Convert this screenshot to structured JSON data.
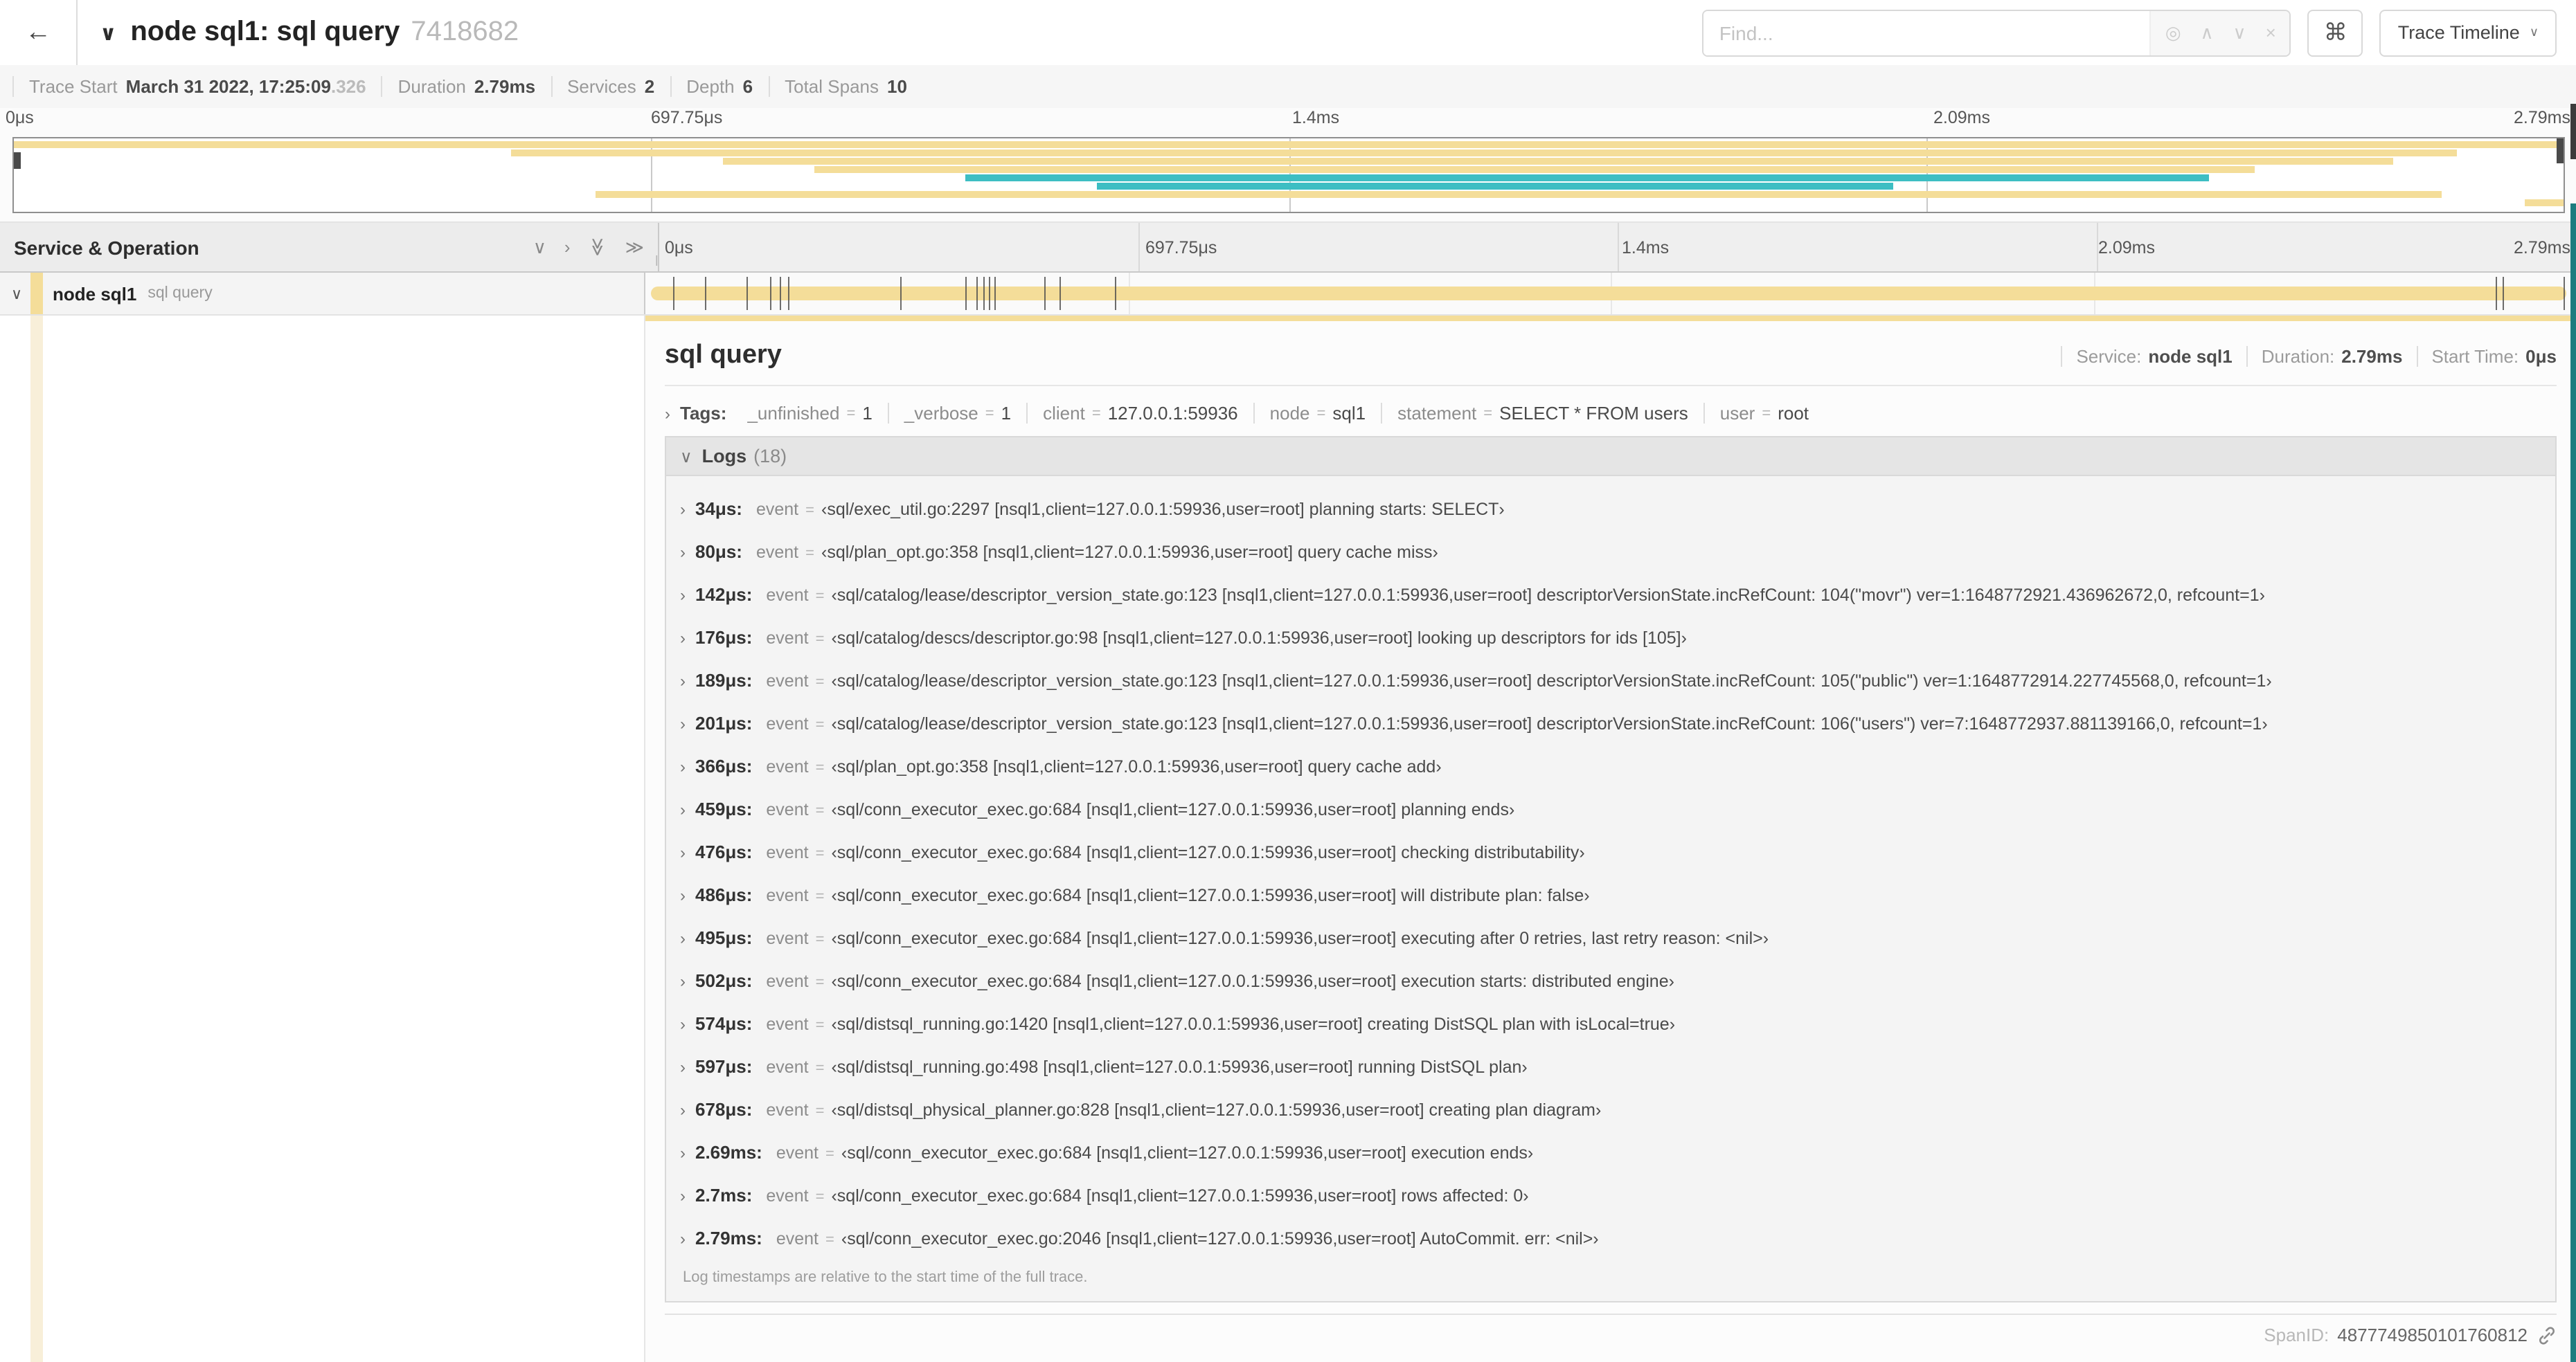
{
  "icons": {
    "back": "←",
    "chevron_down": "∨",
    "chevron_up": "∧",
    "chevron_right": "›",
    "double_chevron": "≫",
    "locate": "◎",
    "clear": "×",
    "command": "⌘",
    "grip": "‖"
  },
  "colors": {
    "span_tan": "#F4DD99",
    "span_teal": "#3DBEC3",
    "faded_tan": "#F8EFD9"
  },
  "header": {
    "title": "node sql1: sql query",
    "trace_id": "7418682",
    "find_placeholder": "Find...",
    "view_dropdown": "Trace Timeline"
  },
  "summary": {
    "items": [
      {
        "label": "Trace Start",
        "value": "March 31 2022, 17:25:09",
        "suffix": ".326"
      },
      {
        "label": "Duration",
        "value": "2.79ms"
      },
      {
        "label": "Services",
        "value": "2"
      },
      {
        "label": "Depth",
        "value": "6"
      },
      {
        "label": "Total Spans",
        "value": "10"
      }
    ]
  },
  "timeline": {
    "ticks": [
      "0μs",
      "697.75μs",
      "1.4ms",
      "2.09ms",
      "2.79ms"
    ],
    "duration_us": 2790,
    "log_marker_times_us": [
      34,
      80,
      142,
      176,
      189,
      201,
      366,
      459,
      476,
      486,
      495,
      502,
      574,
      597,
      678,
      2690,
      2700,
      2790
    ],
    "minimap_rows": [
      {
        "color": "tan",
        "start": 0,
        "end": 1
      },
      {
        "color": "tan",
        "start": 0.195,
        "end": 0.958
      },
      {
        "color": "tan",
        "start": 0.278,
        "end": 0.933
      },
      {
        "color": "tan",
        "start": 0.314,
        "end": 0.879
      },
      {
        "color": "teal",
        "start": 0.373,
        "end": 0.861
      },
      {
        "color": "teal",
        "start": 0.425,
        "end": 0.737
      },
      {
        "color": "tan",
        "start": 0.228,
        "end": 0.952
      },
      {
        "color": "tan",
        "start": 0.985,
        "end": 1.0
      }
    ]
  },
  "span_table": {
    "header": "Service & Operation",
    "row": {
      "service": "node sql1",
      "operation": "sql query"
    }
  },
  "detail": {
    "title": "sql query",
    "meta": [
      {
        "label": "Service:",
        "value": "node sql1"
      },
      {
        "label": "Duration:",
        "value": "2.79ms"
      },
      {
        "label": "Start Time:",
        "value": "0μs"
      }
    ],
    "tags_label": "Tags:",
    "tags": [
      {
        "key": "_unfinished",
        "value": "1"
      },
      {
        "key": "_verbose",
        "value": "1"
      },
      {
        "key": "client",
        "value": "127.0.0.1:59936"
      },
      {
        "key": "node",
        "value": "sql1"
      },
      {
        "key": "statement",
        "value": "SELECT * FROM users"
      },
      {
        "key": "user",
        "value": "root"
      }
    ],
    "logs_label": "Logs",
    "logs_count": "(18)",
    "logs": [
      {
        "time": "34μs:",
        "key": "event",
        "value": "‹sql/exec_util.go:2297 [nsql1,client=127.0.0.1:59936,user=root] planning starts: SELECT›"
      },
      {
        "time": "80μs:",
        "key": "event",
        "value": "‹sql/plan_opt.go:358 [nsql1,client=127.0.0.1:59936,user=root] query cache miss›"
      },
      {
        "time": "142μs:",
        "key": "event",
        "value": "‹sql/catalog/lease/descriptor_version_state.go:123 [nsql1,client=127.0.0.1:59936,user=root] descriptorVersionState.incRefCount: 104(\"movr\") ver=1:1648772921.436962672,0, refcount=1›"
      },
      {
        "time": "176μs:",
        "key": "event",
        "value": "‹sql/catalog/descs/descriptor.go:98 [nsql1,client=127.0.0.1:59936,user=root] looking up descriptors for ids [105]›"
      },
      {
        "time": "189μs:",
        "key": "event",
        "value": "‹sql/catalog/lease/descriptor_version_state.go:123 [nsql1,client=127.0.0.1:59936,user=root] descriptorVersionState.incRefCount: 105(\"public\") ver=1:1648772914.227745568,0, refcount=1›"
      },
      {
        "time": "201μs:",
        "key": "event",
        "value": "‹sql/catalog/lease/descriptor_version_state.go:123 [nsql1,client=127.0.0.1:59936,user=root] descriptorVersionState.incRefCount: 106(\"users\") ver=7:1648772937.881139166,0, refcount=1›"
      },
      {
        "time": "366μs:",
        "key": "event",
        "value": "‹sql/plan_opt.go:358 [nsql1,client=127.0.0.1:59936,user=root] query cache add›"
      },
      {
        "time": "459μs:",
        "key": "event",
        "value": "‹sql/conn_executor_exec.go:684 [nsql1,client=127.0.0.1:59936,user=root] planning ends›"
      },
      {
        "time": "476μs:",
        "key": "event",
        "value": "‹sql/conn_executor_exec.go:684 [nsql1,client=127.0.0.1:59936,user=root] checking distributability›"
      },
      {
        "time": "486μs:",
        "key": "event",
        "value": "‹sql/conn_executor_exec.go:684 [nsql1,client=127.0.0.1:59936,user=root] will distribute plan: false›"
      },
      {
        "time": "495μs:",
        "key": "event",
        "value": "‹sql/conn_executor_exec.go:684 [nsql1,client=127.0.0.1:59936,user=root] executing after 0 retries, last retry reason: <nil>›"
      },
      {
        "time": "502μs:",
        "key": "event",
        "value": "‹sql/conn_executor_exec.go:684 [nsql1,client=127.0.0.1:59936,user=root] execution starts: distributed engine›"
      },
      {
        "time": "574μs:",
        "key": "event",
        "value": "‹sql/distsql_running.go:1420 [nsql1,client=127.0.0.1:59936,user=root] creating DistSQL plan with isLocal=true›"
      },
      {
        "time": "597μs:",
        "key": "event",
        "value": "‹sql/distsql_running.go:498 [nsql1,client=127.0.0.1:59936,user=root] running DistSQL plan›"
      },
      {
        "time": "678μs:",
        "key": "event",
        "value": "‹sql/distsql_physical_planner.go:828 [nsql1,client=127.0.0.1:59936,user=root] creating plan diagram›"
      },
      {
        "time": "2.69ms:",
        "key": "event",
        "value": "‹sql/conn_executor_exec.go:684 [nsql1,client=127.0.0.1:59936,user=root] execution ends›"
      },
      {
        "time": "2.7ms:",
        "key": "event",
        "value": "‹sql/conn_executor_exec.go:684 [nsql1,client=127.0.0.1:59936,user=root] rows affected: 0›"
      },
      {
        "time": "2.79ms:",
        "key": "event",
        "value": "‹sql/conn_executor_exec.go:2046 [nsql1,client=127.0.0.1:59936,user=root] AutoCommit. err: <nil>›"
      }
    ],
    "footnote": "Log timestamps are relative to the start time of the full trace.",
    "span_id_label": "SpanID:",
    "span_id": "4877749850101760812"
  }
}
